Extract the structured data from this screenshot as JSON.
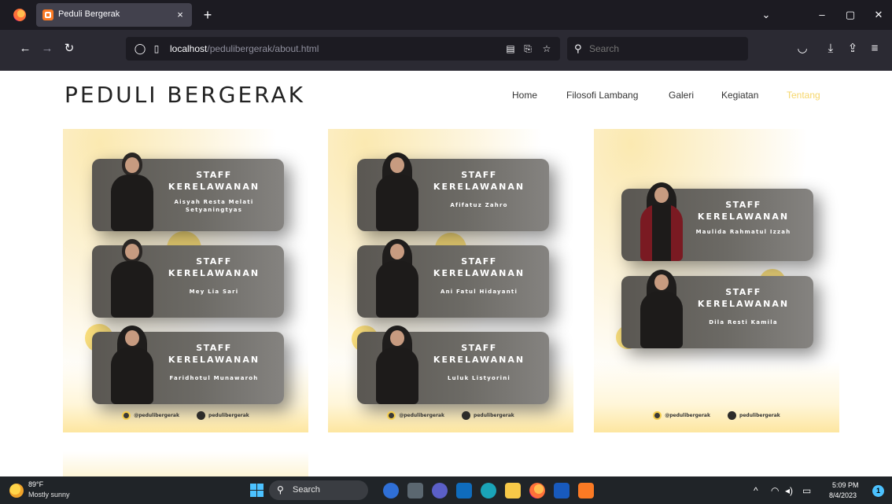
{
  "browser": {
    "tab_title": "Peduli Bergerak",
    "tab_close": "×",
    "new_tab": "+",
    "url_host": "localhost",
    "url_path": "/pedulibergerak/about.html",
    "search_placeholder": "Search",
    "window_controls": {
      "chevron": "⌄",
      "minimize": "–",
      "maximize": "▢",
      "close": "✕"
    }
  },
  "site": {
    "brand": "PEDULI BERGERAK",
    "menu": [
      "Home",
      "Filosofi Lambang",
      "Galeri",
      "Kegiatan",
      "Tentang"
    ],
    "active_menu": "Tentang",
    "accent": "#f6d66a"
  },
  "posters": [
    {
      "cards": [
        {
          "role1": "STAFF",
          "role2": "KERELAWANAN",
          "name": "Aisyah Resta Melati Setyaningtyas"
        },
        {
          "role1": "STAFF",
          "role2": "KERELAWANAN",
          "name": "Mey Lia Sari"
        },
        {
          "role1": "STAFF",
          "role2": "KERELAWANAN",
          "name": "Faridhotul Munawaroh"
        }
      ],
      "footer_ig": "@pedulibergerak",
      "footer_tt": "pedulibergerak"
    },
    {
      "cards": [
        {
          "role1": "STAFF",
          "role2": "KERELAWANAN",
          "name": "Afifatuz Zahro"
        },
        {
          "role1": "STAFF",
          "role2": "KERELAWANAN",
          "name": "Ani Fatul Hidayanti"
        },
        {
          "role1": "STAFF",
          "role2": "KERELAWANAN",
          "name": "Luluk Listyorini"
        }
      ],
      "footer_ig": "@pedulibergerak",
      "footer_tt": "pedulibergerak"
    },
    {
      "cards": [
        {
          "role1": "STAFF",
          "role2": "KERELAWANAN",
          "name": "Maulida Rahmatul Izzah"
        },
        {
          "role1": "STAFF",
          "role2": "KERELAWANAN",
          "name": "Dila Resti Kamila"
        }
      ],
      "footer_ig": "@pedulibergerak",
      "footer_tt": "pedulibergerak"
    }
  ],
  "taskbar": {
    "weather_temp": "89°F",
    "weather_desc": "Mostly sunny",
    "search_label": "Search",
    "time": "5:09 PM",
    "date": "8/4/2023",
    "notification_count": "1",
    "tray_chevron": "^"
  }
}
